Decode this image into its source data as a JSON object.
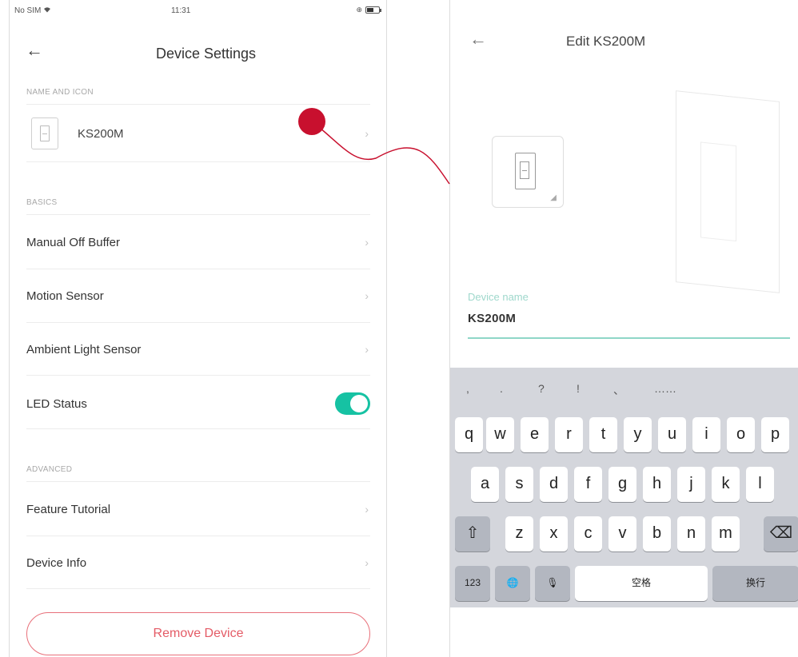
{
  "left": {
    "status": {
      "carrier": "No SIM",
      "time": "11:31"
    },
    "header": {
      "back": "←",
      "title": "Device Settings"
    },
    "name_section": {
      "header": "NAME AND ICON",
      "device_name": "KS200M"
    },
    "basics": {
      "header": "BASICS",
      "items": [
        {
          "label": "Manual Off Buffer"
        },
        {
          "label": "Motion Sensor"
        },
        {
          "label": "Ambient Light Sensor"
        },
        {
          "label": "LED Status",
          "toggle_on": true
        }
      ]
    },
    "advanced": {
      "header": "ADVANCED",
      "items": [
        {
          "label": "Feature Tutorial"
        },
        {
          "label": "Device Info"
        }
      ]
    },
    "remove_button": "Remove Device",
    "chevron": "›"
  },
  "right": {
    "header": {
      "back": "←",
      "title": "Edit KS200M"
    },
    "field": {
      "label": "Device name",
      "value": "KS200M"
    },
    "keyboard": {
      "suggestions": [
        ",",
        ".",
        "?",
        "!",
        "、",
        "……"
      ],
      "row1": [
        "q",
        "w",
        "e",
        "r",
        "t",
        "y",
        "u",
        "i",
        "o",
        "p"
      ],
      "row2": [
        "a",
        "s",
        "d",
        "f",
        "g",
        "h",
        "j",
        "k",
        "l"
      ],
      "row3": [
        "z",
        "x",
        "c",
        "v",
        "b",
        "n",
        "m"
      ],
      "shift": "⇧",
      "delete": "⌫",
      "numbers": "123",
      "globe": "🌐",
      "mic": "🎙",
      "space": "空格",
      "return": "换行"
    }
  },
  "colors": {
    "accent_teal": "#16c2a3",
    "danger_red": "#e45b66",
    "connector_red": "#c8102e"
  }
}
